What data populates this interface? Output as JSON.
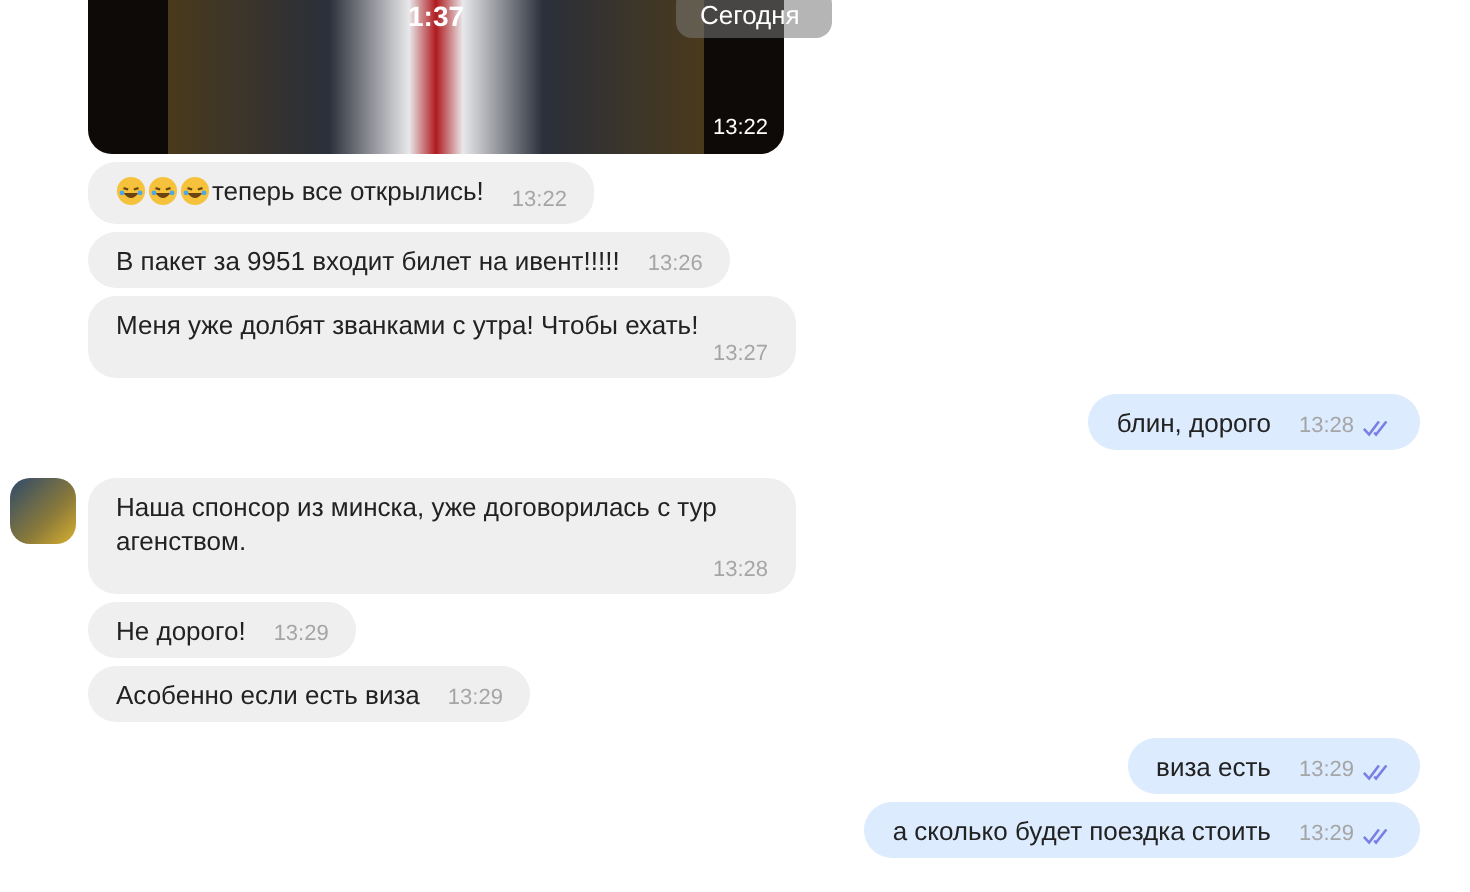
{
  "video": {
    "duration": "1:37",
    "time": "13:22"
  },
  "date_badge": "Сегодня",
  "messages": [
    {
      "kind": "incoming_emoji",
      "text": "теперь все открылись!",
      "time": "13:22",
      "avatar": false
    },
    {
      "kind": "incoming",
      "text": "В пакет за 9951 входит билет на ивент!!!!!",
      "time": "13:26",
      "avatar": false
    },
    {
      "kind": "incoming",
      "text": "Меня уже долбят званками с утра! Чтобы ехать!",
      "time": "13:27",
      "avatar": false
    },
    {
      "kind": "outgoing",
      "text": "блин, дорого",
      "time": "13:28",
      "read": true
    },
    {
      "kind": "incoming",
      "text": "Наша спонсор из минска, уже договорилась с тур агенством.",
      "time": "13:28",
      "avatar": true
    },
    {
      "kind": "incoming",
      "text": "Не дорого!",
      "time": "13:29",
      "avatar": false
    },
    {
      "kind": "incoming",
      "text": "Асобенно если есть виза",
      "time": "13:29",
      "avatar": false
    },
    {
      "kind": "outgoing",
      "text": "виза есть",
      "time": "13:29",
      "read": true
    },
    {
      "kind": "outgoing",
      "text": "а сколько будет поездка стоить",
      "time": "13:29",
      "read": true
    }
  ]
}
